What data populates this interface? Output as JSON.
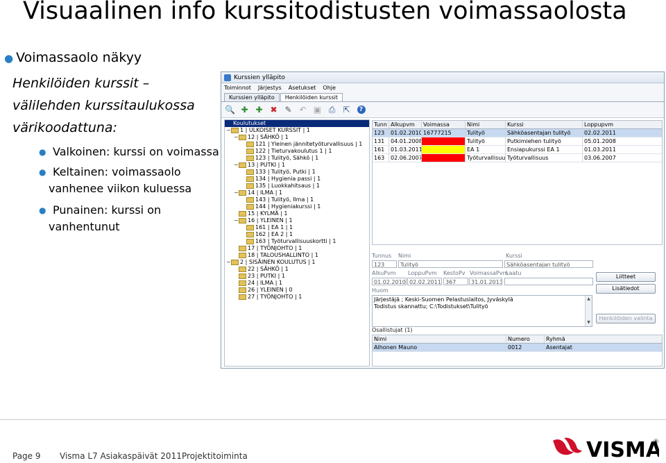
{
  "slide": {
    "title": "Visuaalinen info kurssitodistusten voimassaolosta",
    "bullet": "Voimassaolo näkyy",
    "italic": [
      "Henkilöiden kurssit –",
      "välilehden kurssitaulukossa",
      "värikoodattuna:"
    ],
    "sub": [
      {
        "lines": [
          "Valkoinen: kurssi on voimassa"
        ]
      },
      {
        "lines": [
          "Keltainen: voimassaolo",
          "vanhenee viikon kuluessa"
        ]
      },
      {
        "lines": [
          "Punainen: kurssi on",
          "vanhentunut"
        ]
      }
    ],
    "accent": "#2a7fc4"
  },
  "window": {
    "title": "Kurssien ylläpito",
    "menus": [
      "Toiminnot",
      "Järjestys",
      "Asetukset",
      "Ohje"
    ],
    "tabs": [
      "Kurssien ylläpito",
      "Henkilöiden kurssit"
    ],
    "toolbar_icons": [
      "search-icon",
      "add-icon",
      "add-sub-icon",
      "delete-icon",
      "edit-icon",
      "undo-icon",
      "save-icon",
      "print-icon",
      "export-icon",
      "help-icon"
    ],
    "tree_header": "Koulutukset",
    "tree": [
      {
        "level": 0,
        "ex": "-",
        "label": "1 | ULKOISET KURSSIT | 1"
      },
      {
        "level": 1,
        "ex": "-",
        "label": "12 | SÄHKÖ | 1"
      },
      {
        "level": 2,
        "ex": "",
        "label": "121 | Yleinen jännitetyöturvallisuus | 1"
      },
      {
        "level": 2,
        "ex": "",
        "label": "122 | Tieturvakoulutus 1 | 1"
      },
      {
        "level": 2,
        "ex": "",
        "label": "123 | Tulityö, Sähkö | 1"
      },
      {
        "level": 1,
        "ex": "-",
        "label": "13 | PUTKI | 1"
      },
      {
        "level": 2,
        "ex": "",
        "label": "133 | Tulityö, Putki | 1"
      },
      {
        "level": 2,
        "ex": "",
        "label": "134 | Hygienia passi | 1"
      },
      {
        "level": 2,
        "ex": "",
        "label": "135 | Luokkahitsaus | 1"
      },
      {
        "level": 1,
        "ex": "-",
        "label": "14 | ILMA | 1"
      },
      {
        "level": 2,
        "ex": "",
        "label": "143 | Tulityö, Ilma | 1"
      },
      {
        "level": 2,
        "ex": "",
        "label": "144 | Hygieniakurssi | 1"
      },
      {
        "level": 1,
        "ex": "",
        "label": "15 | KYLMÄ | 1"
      },
      {
        "level": 1,
        "ex": "-",
        "label": "16 | YLEINEN | 1"
      },
      {
        "level": 2,
        "ex": "",
        "label": "161 | EA 1 | 1"
      },
      {
        "level": 2,
        "ex": "",
        "label": "162 | EA 2 | 1"
      },
      {
        "level": 2,
        "ex": "",
        "label": "163 | Työturvallisuuskortti | 1"
      },
      {
        "level": 1,
        "ex": "",
        "label": "17 | TYÖNJOHTO | 1"
      },
      {
        "level": 1,
        "ex": "",
        "label": "18 | TALOUSHALLINTO | 1"
      },
      {
        "level": 0,
        "ex": "-",
        "label": "2 | SISÄINEN KOULUTUS | 1"
      },
      {
        "level": 1,
        "ex": "",
        "label": "22 | SÄHKÖ | 1"
      },
      {
        "level": 1,
        "ex": "",
        "label": "23 | PUTKI | 1"
      },
      {
        "level": 1,
        "ex": "",
        "label": "24 | ILMA | 1"
      },
      {
        "level": 1,
        "ex": "",
        "label": "26 | YLEINEN | 0"
      },
      {
        "level": 1,
        "ex": "",
        "label": "27 | TYÖNJOHTO | 1"
      }
    ],
    "grid": {
      "columns": [
        "Tunn",
        "Alkupvm",
        "Voimassa",
        "Nimi",
        "Kurssi",
        "Loppupvm"
      ],
      "rows": [
        {
          "cells": [
            "123",
            "01.02.2010",
            "16777215",
            "Tulityö",
            "Sähköasentajan tulityö",
            "02.02.2011"
          ],
          "color": "#ffffff",
          "selected": true
        },
        {
          "cells": [
            "131",
            "04.01.2008",
            "",
            "Tulityö",
            "Putkimiehen tulityö",
            "05.01.2008"
          ],
          "color": "#ff0000",
          "selected": false
        },
        {
          "cells": [
            "161",
            "01.03.2011",
            "",
            "EA 1",
            "Ensiapukurssi EA 1",
            "01.03.2011"
          ],
          "color": "#ffff00",
          "selected": false
        },
        {
          "cells": [
            "163",
            "02.06.2007",
            "",
            "Työturvallisuuskortti",
            "Työturvallisuus",
            "03.06.2007"
          ],
          "color": "#ff0000",
          "selected": false
        }
      ]
    },
    "detail": {
      "labels": {
        "tunnus": "Tunnus",
        "nimi": "Nimi",
        "kurssi": "Kurssi",
        "alkupvm": "AlkuPvm",
        "loppupvm": "LoppuPvm",
        "kestopv": "KestoPv",
        "voimassapvm": "VoimassaPvm",
        "laatu": "Laatu",
        "huom": "Huom"
      },
      "values": {
        "tunnus": "123",
        "nimi": "Tulityö",
        "kurssi": "Sähköasentajan tulityö",
        "alkupvm": "01.02.2010",
        "loppupvm": "02.02.2011",
        "kestopv": "367",
        "voimassapvm": "31.01.2013",
        "laatu": ""
      },
      "notes": [
        "Järjestäjä ; Keski-Suomen Pelastuslaitos, Jyväskylä",
        "Todistus skannattu; C:\\Todistukset\\Tulityö"
      ]
    },
    "buttons": {
      "liitteet": "Liitteet",
      "lisatiedot": "Lisätiedot",
      "henkiloiden_valinta": "Henkilöiden valinta"
    },
    "participants": {
      "title": "Osallistujat (1)",
      "columns": [
        "Nimi",
        "Numero",
        "Ryhmä"
      ],
      "rows": [
        [
          "Alhonen Mauno",
          "0012",
          "Asentajat"
        ]
      ]
    }
  },
  "footer": {
    "page": "Page 9",
    "event": "Visma L7 Asiakaspäivät 2011",
    "section": "Projektitoiminta"
  },
  "logo": {
    "text": "VISMA",
    "registered": "®",
    "color": "#d0102b"
  }
}
